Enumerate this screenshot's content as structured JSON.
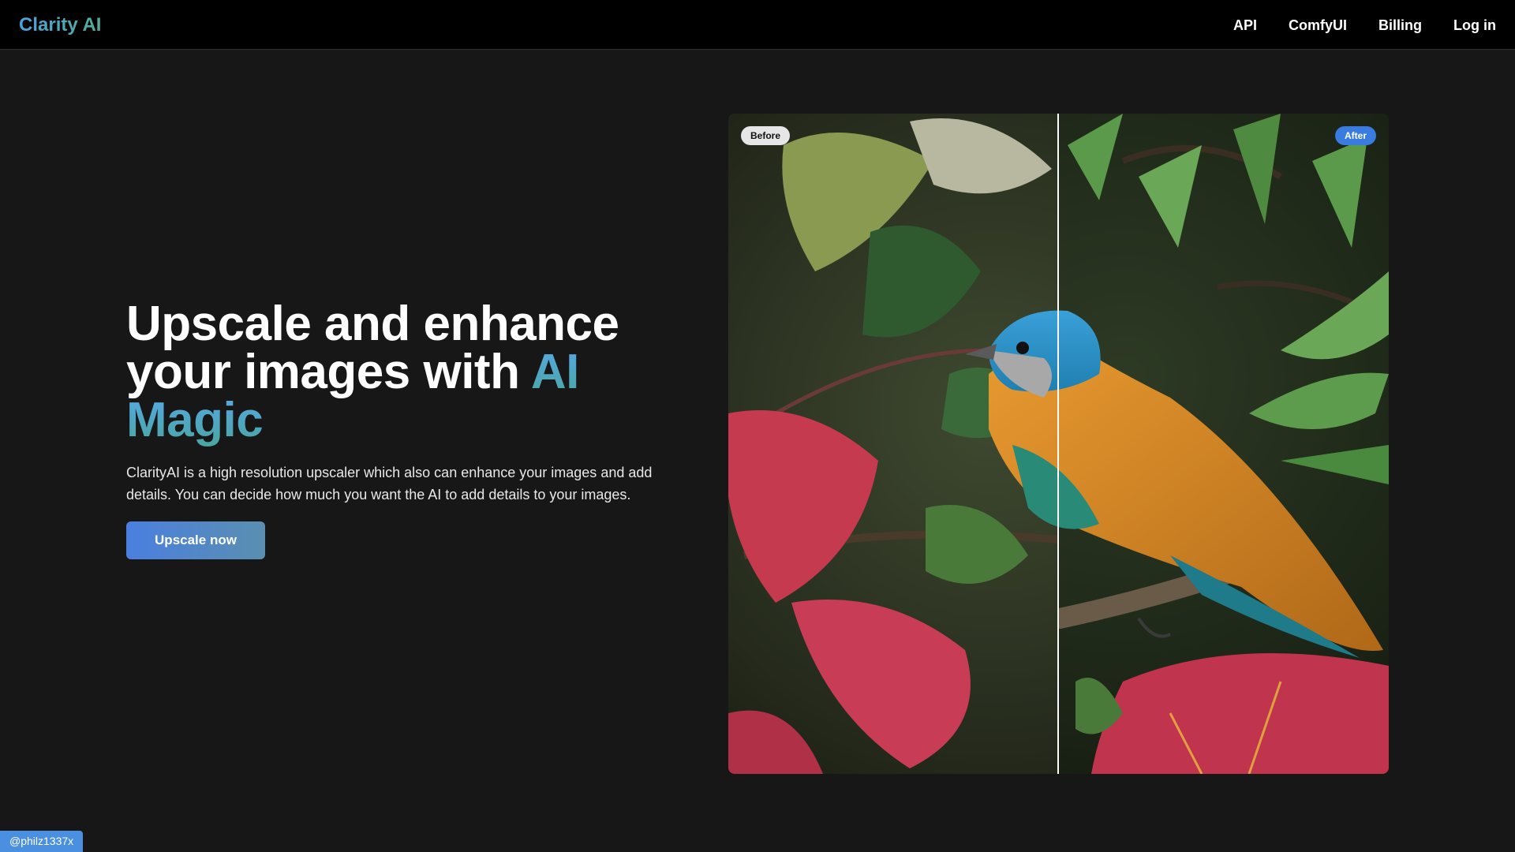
{
  "nav": {
    "brand": "Clarity AI",
    "links": [
      "API",
      "ComfyUI",
      "Billing",
      "Log in"
    ]
  },
  "hero": {
    "headline_line1": "Upscale and enhance",
    "headline_line2": "your images with ",
    "headline_accent_1": "AI",
    "headline_accent_2": "Magic",
    "description": "ClarityAI is a high resolution upscaler which also can enhance your images and add details. You can decide how much you want the AI to add details to your images.",
    "cta_label": "Upscale now"
  },
  "comparison": {
    "before_label": "Before",
    "after_label": "After",
    "split_fraction": 0.5
  },
  "credit": "@philz1337x",
  "colors": {
    "background": "#171717",
    "navbar": "#000000",
    "accent_blue": "#4aa3df",
    "accent_teal": "#4fae96",
    "button": "#4a7fe0",
    "after_badge": "#3a7be0"
  }
}
